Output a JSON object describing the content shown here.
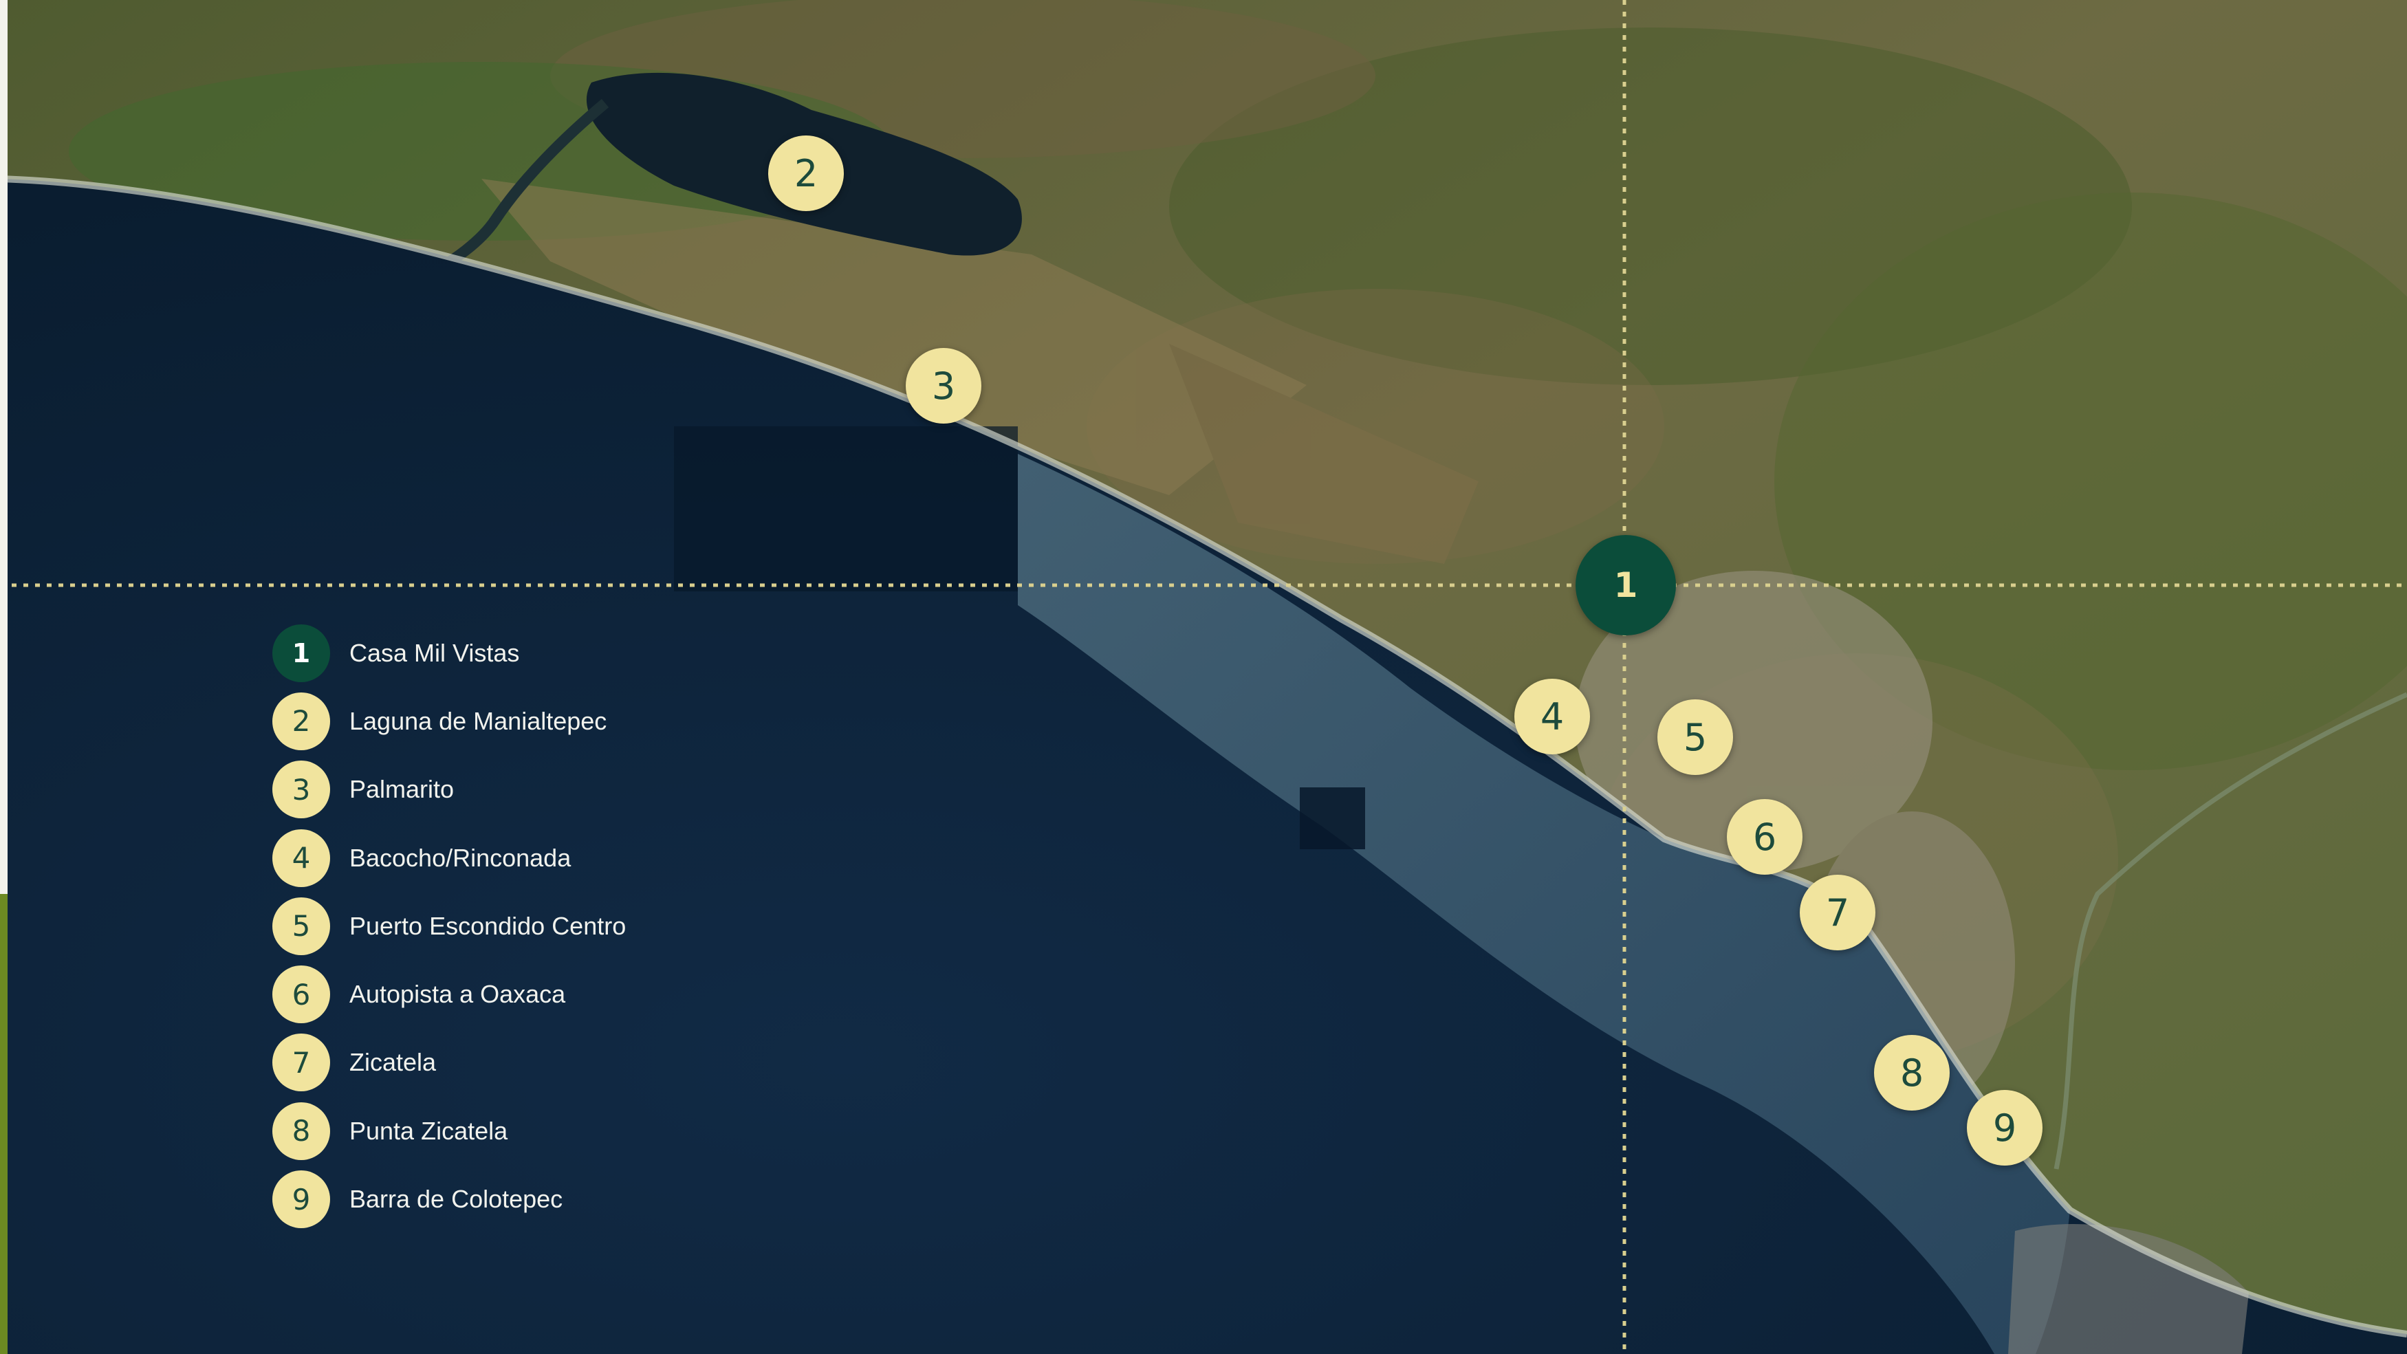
{
  "markers": [
    {
      "number": "1",
      "label": "Casa Mil Vistas",
      "primary": true
    },
    {
      "number": "2",
      "label": "Laguna de Manialtepec"
    },
    {
      "number": "3",
      "label": "Palmarito"
    },
    {
      "number": "4",
      "label": "Bacocho/Rinconada"
    },
    {
      "number": "5",
      "label": "Puerto Escondido Centro"
    },
    {
      "number": "6",
      "label": "Autopista a Oaxaca"
    },
    {
      "number": "7",
      "label": "Zicatela"
    },
    {
      "number": "8",
      "label": "Punta Zicatela"
    },
    {
      "number": "9",
      "label": "Barra de Colotepec"
    }
  ],
  "colors": {
    "marker_fill": "#f1e49e",
    "marker_text": "#1d4b3c",
    "primary_marker_fill": "#0b4d3a",
    "crosshair": "#d9cf8e",
    "ocean_deep": "#0c2236",
    "land": "#5f6a3c"
  }
}
